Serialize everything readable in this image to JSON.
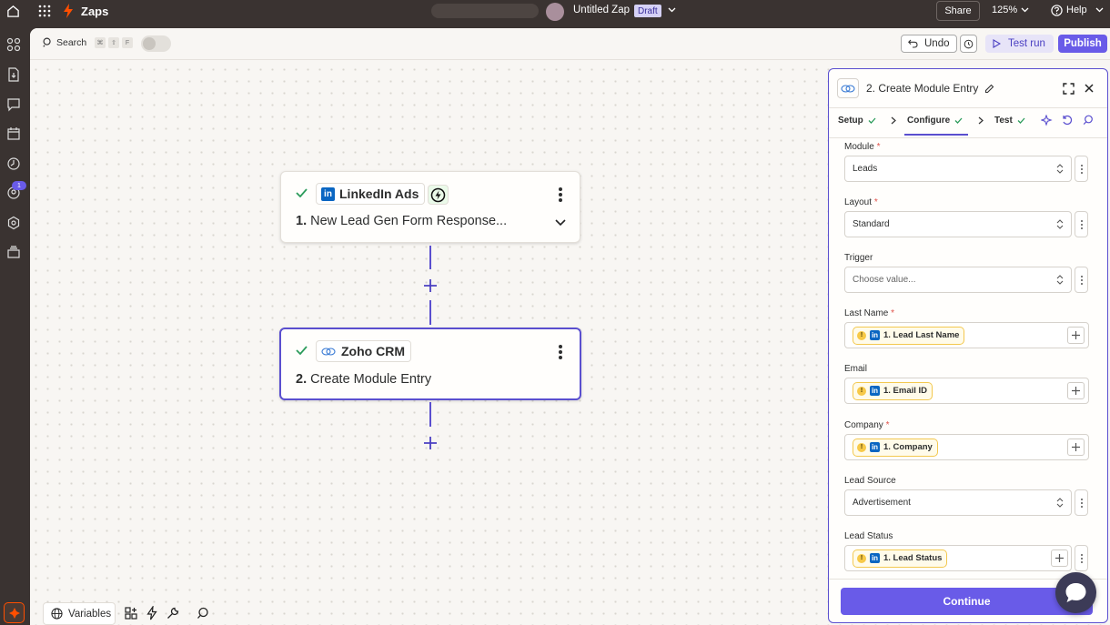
{
  "topbar": {
    "app_name": "Zaps",
    "zap_title": "Untitled Zap",
    "draft_badge": "Draft",
    "share_label": "Share",
    "zoom": "125%",
    "help_label": "Help"
  },
  "left_rail": {
    "notification_count": "1"
  },
  "toolbar": {
    "search_label": "Search",
    "search_keys": [
      "⌘",
      "⇧",
      "F"
    ],
    "undo_label": "Undo",
    "test_run_label": "Test run",
    "publish_label": "Publish"
  },
  "canvas": {
    "trigger_step": {
      "app_name": "LinkedIn Ads",
      "title_number": "1.",
      "title": "New Lead Gen Form Response..."
    },
    "action_step": {
      "app_name": "Zoho CRM",
      "title_number": "2.",
      "title": "Create Module Entry"
    }
  },
  "panel": {
    "title": "2. Create Module Entry",
    "tabs": [
      {
        "label": "Setup",
        "done": true
      },
      {
        "label": "Configure",
        "done": true,
        "active": true
      },
      {
        "label": "Test",
        "done": true
      }
    ],
    "fields": {
      "module": {
        "label": "Module",
        "required": "*",
        "value": "Leads"
      },
      "layout": {
        "label": "Layout",
        "required": "*",
        "value": "Standard"
      },
      "trigger": {
        "label": "Trigger",
        "placeholder": "Choose value..."
      },
      "last_name": {
        "label": "Last Name",
        "required": "*",
        "pill": "1. Lead Last Name"
      },
      "email": {
        "label": "Email",
        "pill": "1. Email ID"
      },
      "company": {
        "label": "Company",
        "required": "*",
        "pill": "1. Company"
      },
      "lead_source": {
        "label": "Lead Source",
        "value": "Advertisement"
      },
      "lead_status": {
        "label": "Lead Status",
        "pill": "1. Lead Status"
      }
    },
    "continue_label": "Continue"
  },
  "bottom_bar": {
    "variables_label": "Variables"
  },
  "colors": {
    "accent": "#5a4fcf",
    "publish_bg": "#695be8",
    "zapier_orange": "#ff4f00",
    "linkedin_blue": "#0a66c2",
    "success_green": "#2d9c5c",
    "required_red": "#e0524a"
  }
}
